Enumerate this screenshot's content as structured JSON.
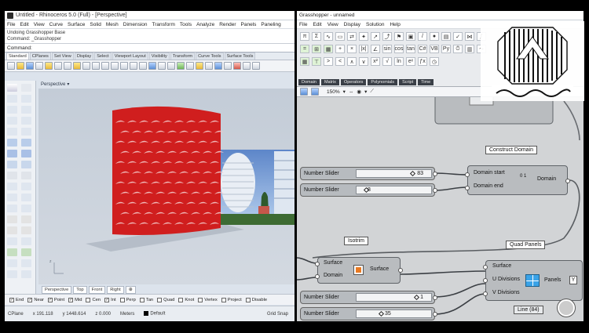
{
  "rhino": {
    "title": "Untitled - Rhinoceros 5.0 (Full) - [Perspective]",
    "menu": [
      "File",
      "Edit",
      "View",
      "Curve",
      "Surface",
      "Solid",
      "Mesh",
      "Dimension",
      "Transform",
      "Tools",
      "Analyze",
      "Render",
      "Panels",
      "Paneling"
    ],
    "history": [
      "Undoing Grasshopper Base",
      "Command: _Grasshopper"
    ],
    "command_label": "Command:",
    "tabs": [
      "Standard",
      "CPlanes",
      "Set View",
      "Display",
      "Select",
      "Viewport Layout",
      "Visibility",
      "Transform",
      "Curve Tools",
      "Surface Tools"
    ],
    "viewport_label": "Perspective",
    "view_tabs": [
      "Perspective",
      "Top",
      "Front",
      "Right"
    ],
    "osnaps": [
      {
        "label": "End",
        "checked": true
      },
      {
        "label": "Near",
        "checked": true
      },
      {
        "label": "Point",
        "checked": true
      },
      {
        "label": "Mid",
        "checked": true
      },
      {
        "label": "Cen",
        "checked": false
      },
      {
        "label": "Int",
        "checked": true
      },
      {
        "label": "Perp",
        "checked": false
      },
      {
        "label": "Tan",
        "checked": false
      },
      {
        "label": "Quad",
        "checked": false
      },
      {
        "label": "Knot",
        "checked": false
      },
      {
        "label": "Vertex",
        "checked": false
      },
      {
        "label": "Project",
        "checked": false
      },
      {
        "label": "Disable",
        "checked": false
      }
    ],
    "status": {
      "cplane": "CPlane",
      "x": "x 191.118",
      "y": "y 1448.614",
      "z": "z 0.000",
      "units": "Meters",
      "layer": "Default",
      "grid_snap": "Grid Snap"
    },
    "colors": {
      "facade": "#d01e1e",
      "viewport_bg": "#c8d0da"
    }
  },
  "grasshopper": {
    "title": "Grasshopper - unnamed",
    "menu": [
      "File",
      "Edit",
      "View",
      "Display",
      "Solution",
      "Help"
    ],
    "ribbon_tabs": [
      "Domain",
      "Matrix",
      "Operators",
      "Polynomials",
      "Script",
      "Time"
    ],
    "zoom": "150%",
    "components": {
      "construct_domain": {
        "title": "Construct Domain",
        "inputs": [
          "Domain start",
          "Domain end"
        ],
        "output": "Domain"
      },
      "isotrim": {
        "title": "Isotrim",
        "inputs": [
          "Surface",
          "Domain"
        ],
        "output": "Surface"
      },
      "quad_panels": {
        "title": "Quad Panels",
        "inputs": [
          "Surface",
          "U Divisions",
          "V Divisions"
        ],
        "output": "Panels",
        "line_label": "Line (84)"
      }
    },
    "sliders": [
      {
        "name": "Number Slider",
        "value": "83",
        "fraction": 0.82
      },
      {
        "name": "Number Slider",
        "value": "8",
        "fraction": 0.12
      },
      {
        "name": "Number Slider",
        "value": "1",
        "fraction": 0.88
      },
      {
        "name": "Number Slider",
        "value": "35",
        "fraction": 0.35
      }
    ]
  }
}
